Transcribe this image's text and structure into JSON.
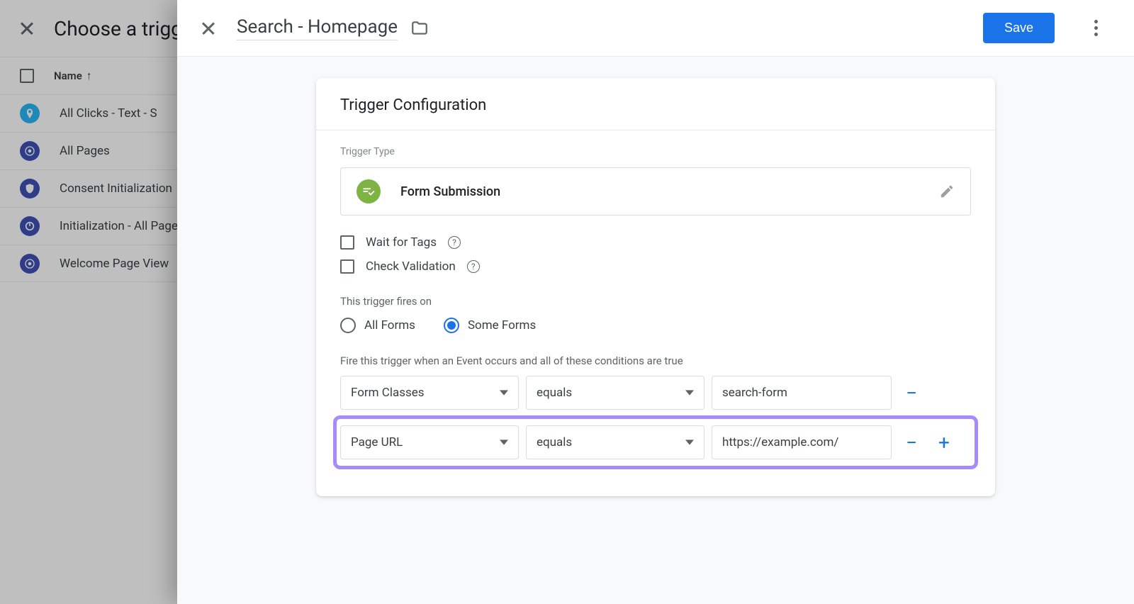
{
  "bg": {
    "title": "Choose a trigger",
    "name_col": "Name",
    "rows": [
      {
        "label": "All Clicks - Text - S",
        "iconBg": "#29b6f6"
      },
      {
        "label": "All Pages",
        "iconBg": "#3f51b5"
      },
      {
        "label": "Consent Initialization",
        "iconBg": "#3f51b5"
      },
      {
        "label": "Initialization - All Pages",
        "iconBg": "#3f51b5"
      },
      {
        "label": "Welcome Page View",
        "iconBg": "#3f51b5"
      }
    ]
  },
  "front": {
    "title": "Search - Homepage",
    "save": "Save"
  },
  "card": {
    "title": "Trigger Configuration",
    "trigger_type_label": "Trigger Type",
    "trigger_type_name": "Form Submission",
    "wait_for_tags": "Wait for Tags",
    "check_validation": "Check Validation",
    "fires_on_label": "This trigger fires on",
    "all_forms": "All Forms",
    "some_forms": "Some Forms",
    "cond_label": "Fire this trigger when an Event occurs and all of these conditions are true",
    "conditions": [
      {
        "variable": "Form Classes",
        "operator": "equals",
        "value": "search-form",
        "highlight": false,
        "showPlus": false
      },
      {
        "variable": "Page URL",
        "operator": "equals",
        "value": "https://example.com/",
        "highlight": true,
        "showPlus": true
      }
    ]
  }
}
